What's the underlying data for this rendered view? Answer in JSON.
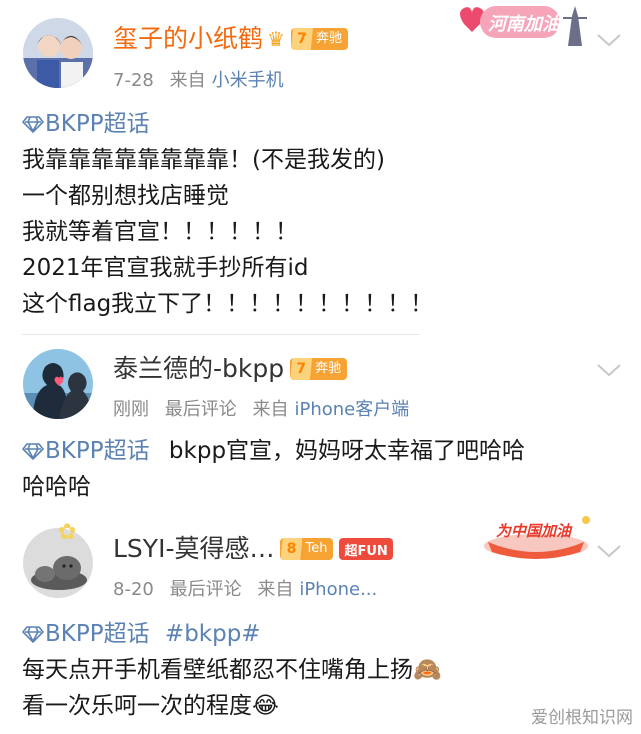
{
  "post1": {
    "username": "玺子的小纸鹤",
    "crown_icon": "crown-icon",
    "badge_level": "7",
    "badge_text": "奔驰",
    "date": "7-28",
    "from_label": "来自",
    "source": "小米手机",
    "sticker_text": "河南加油",
    "topic": "BKPP超话",
    "lines": [
      "我靠靠靠靠靠靠靠靠！(不是我发的)",
      "一个都别想找店睡觉",
      "我就等着官宣！！！！！！",
      "2021年官宣我就手抄所有id",
      "这个flag我立下了！！！！！！！！！！"
    ]
  },
  "post2": {
    "username": "泰兰德的-bkpp",
    "badge_level": "7",
    "badge_text": "奔驰",
    "time": "刚刚",
    "last_comment": "最后评论",
    "from_label": "来自",
    "source": "iPhone客户端",
    "topic": "BKPP超话",
    "line1_rest": "bkpp官宣，妈妈呀太幸福了吧哈哈",
    "line2": "哈哈哈"
  },
  "post3": {
    "username": "LSYI-莫得感…",
    "badge_level": "8",
    "badge_text": "Teh",
    "fun_badge": "超FUN",
    "date": "8-20",
    "last_comment": "最后评论",
    "from_label": "来自",
    "source": "iPhone...",
    "sticker_text": "为中国加油",
    "topic": "BKPP超话",
    "hashtag": "#bkpp#",
    "line1": "每天点开手机看壁纸都忍不住嘴角上扬🙈",
    "line2": "看一次乐呵一次的程度😂"
  },
  "watermark": "爱创根知识网",
  "colors": {
    "username_orange": "#f46b0f",
    "link_blue": "#5b82b3",
    "badge_gold": "#f7a334",
    "fun_red": "#ef4b3c",
    "meta_gray": "#8a8a8a"
  }
}
